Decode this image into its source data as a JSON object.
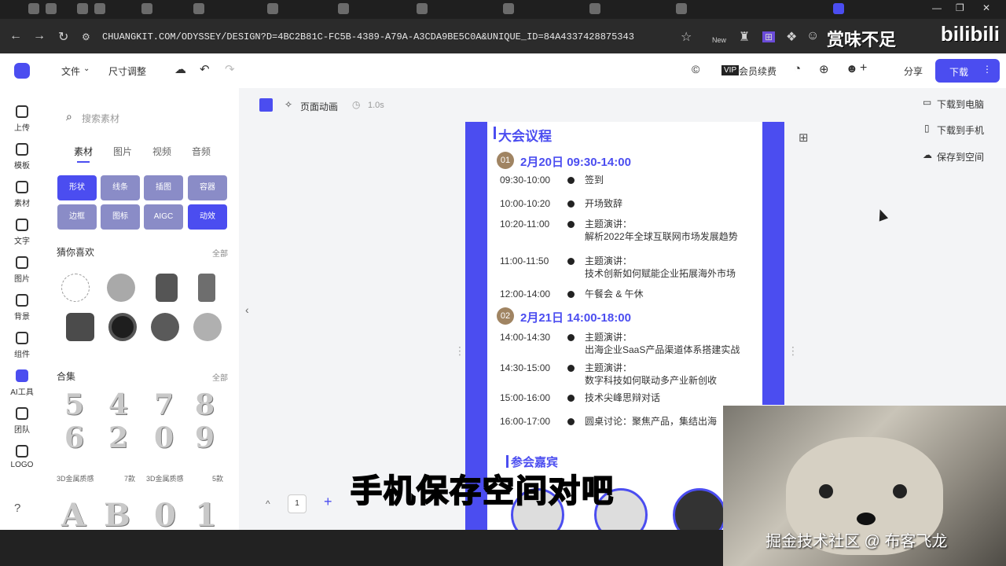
{
  "browser": {
    "url": "CHUANGKIT.COM/ODYSSEY/DESIGN?D=4BC2B81C-FC5B-4389-A79A-A3CDA9BE5C0A&UNIQUE_ID=84A4337428875343",
    "tab_badge": "New",
    "watermark": "bilibili",
    "quote": "赏味不足"
  },
  "topbar": {
    "file_menu": "文件",
    "resize": "尺寸调整",
    "member": "会员续费",
    "share": "分享",
    "download": "下载"
  },
  "leftnav": [
    {
      "label": "上传",
      "icon": "upload-icon"
    },
    {
      "label": "模板",
      "icon": "template-icon"
    },
    {
      "label": "素材",
      "icon": "material-icon"
    },
    {
      "label": "文字",
      "icon": "text-icon"
    },
    {
      "label": "图片",
      "icon": "image-icon"
    },
    {
      "label": "背景",
      "icon": "background-icon"
    },
    {
      "label": "组件",
      "icon": "component-icon"
    },
    {
      "label": "AI工具",
      "icon": "ai-icon"
    },
    {
      "label": "团队",
      "icon": "team-icon"
    },
    {
      "label": "LOGO",
      "icon": "logo-icon"
    }
  ],
  "panel": {
    "search_placeholder": "搜索素材",
    "tabs": [
      "素材",
      "图片",
      "视频",
      "音频"
    ],
    "buttons": [
      "形状",
      "线条",
      "插图",
      "容器",
      "边框",
      "图标",
      "AIGC",
      "动效"
    ],
    "guess_title": "猜你喜欢",
    "guess_more": "全部",
    "collection_title": "合集",
    "collection_more": "全部",
    "digits_top": [
      "5",
      "4",
      "7",
      "8"
    ],
    "digits_bottom": [
      "6",
      "2",
      "0",
      "9"
    ],
    "captions": [
      "3D金属质感",
      "7款",
      "3D金属质感",
      "5款"
    ],
    "letters": [
      "A",
      "B",
      "0",
      "1"
    ]
  },
  "canvasbar": {
    "animation": "页面动画",
    "duration": "1.0s"
  },
  "doc": {
    "agenda_title": "大会议程",
    "day1_badge": "01",
    "day1": "2月20日 09:30-14:00",
    "day1_rows": [
      {
        "time": "09:30-10:00",
        "text": "签到"
      },
      {
        "time": "10:00-10:20",
        "text": "开场致辞"
      },
      {
        "time": "10:20-11:00",
        "text": "主题演讲：",
        "text2": "解析2022年全球互联网市场发展趋势"
      },
      {
        "time": "11:00-11:50",
        "text": "主题演讲：",
        "text2": "技术创新如何赋能企业拓展海外市场"
      },
      {
        "time": "12:00-14:00",
        "text": "午餐会 & 午休"
      }
    ],
    "day2_badge": "02",
    "day2": "2月21日 14:00-18:00",
    "day2_rows": [
      {
        "time": "14:00-14:30",
        "text": "主题演讲：",
        "text2": "出海企业SaaS产品渠道体系搭建实战"
      },
      {
        "time": "14:30-15:00",
        "text": "主题演讲：",
        "text2": "数字科技如何联动多产业新创收"
      },
      {
        "time": "15:00-16:00",
        "text": "技术尖峰思辩对话"
      },
      {
        "time": "16:00-17:00",
        "text": "圆桌讨论：聚焦产品，集结出海"
      }
    ],
    "guests_title": "参会嘉宾"
  },
  "download_menu": [
    "下载到电脑",
    "下载到手机",
    "保存到空间"
  ],
  "pager": {
    "page": "1"
  },
  "subtitle": "手机保存空间对吧",
  "credit": "掘金技术社区 @ 布客飞龙",
  "colors": {
    "accent": "#4b4df0",
    "badge": "#a08462"
  }
}
